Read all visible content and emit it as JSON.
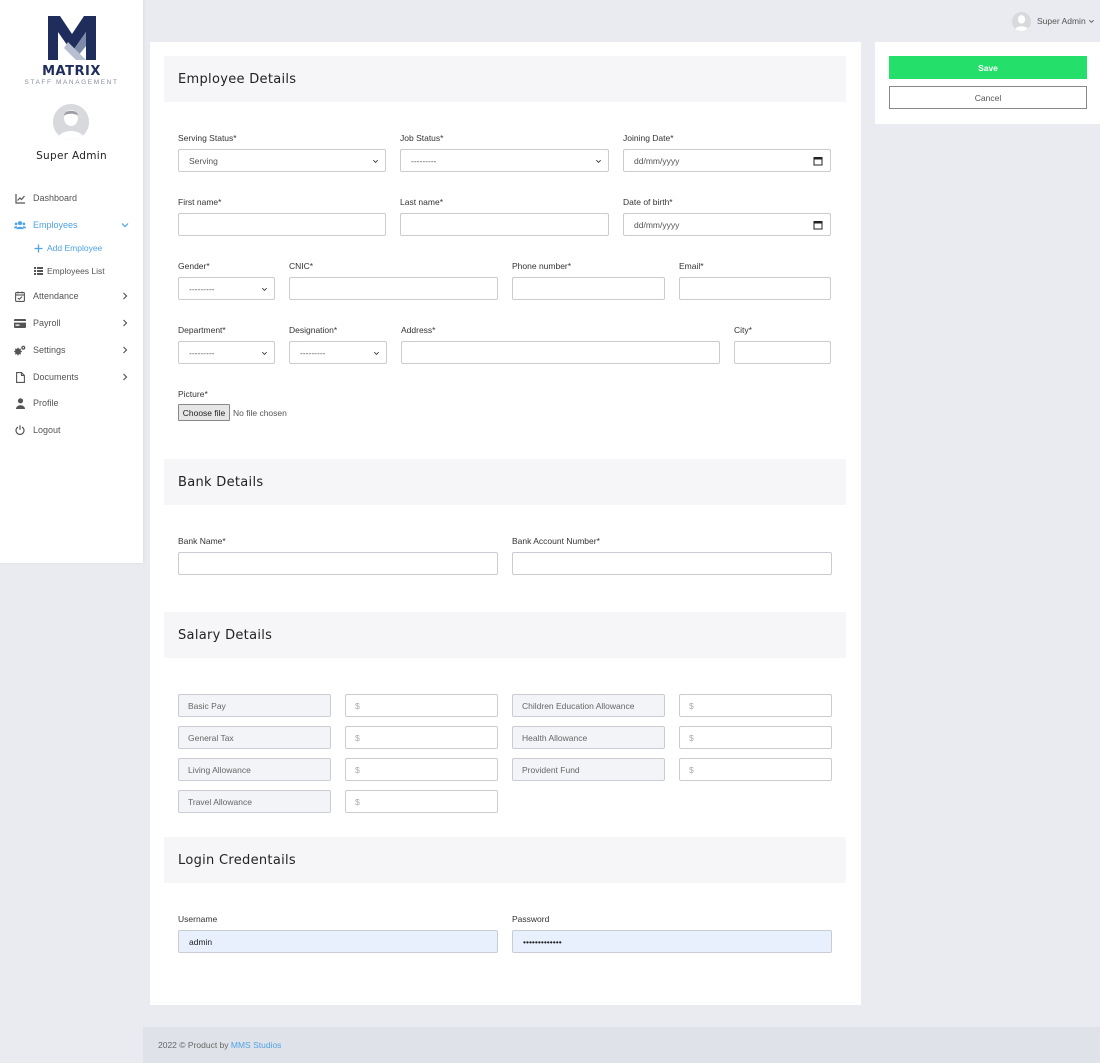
{
  "brand": {
    "name": "MATRIX",
    "subtitle": "STAFF MANAGEMENT",
    "accent": "#1f2d5c"
  },
  "sidebar": {
    "user_name": "Super Admin",
    "items": [
      {
        "label": "Dashboard",
        "icon": "chart-line-icon"
      },
      {
        "label": "Employees",
        "icon": "users-icon",
        "active": true,
        "expanded": true
      },
      {
        "label": "Attendance",
        "icon": "calendar-check-icon"
      },
      {
        "label": "Payroll",
        "icon": "credit-card-icon"
      },
      {
        "label": "Settings",
        "icon": "gears-icon"
      },
      {
        "label": "Documents",
        "icon": "file-icon"
      },
      {
        "label": "Profile",
        "icon": "user-icon"
      },
      {
        "label": "Logout",
        "icon": "power-icon"
      }
    ],
    "sub_items": [
      {
        "label": "Add Employee",
        "icon": "plus-icon",
        "active": true
      },
      {
        "label": "Employees List",
        "icon": "list-icon"
      }
    ]
  },
  "topbar": {
    "user_name": "Super Admin"
  },
  "employee": {
    "title": "Employee Details",
    "serving_status": {
      "label": "Serving Status*",
      "value": "Serving"
    },
    "job_status": {
      "label": "Job Status*",
      "value": "---------"
    },
    "joining_date": {
      "label": "Joining Date*",
      "value": "dd/mm/yyyy"
    },
    "first_name": {
      "label": "First name*",
      "value": ""
    },
    "last_name": {
      "label": "Last name*",
      "value": ""
    },
    "dob": {
      "label": "Date of birth*",
      "value": "dd/mm/yyyy"
    },
    "gender": {
      "label": "Gender*",
      "value": "---------"
    },
    "cnic": {
      "label": "CNIC*",
      "value": ""
    },
    "phone": {
      "label": "Phone number*",
      "value": ""
    },
    "email": {
      "label": "Email*",
      "value": ""
    },
    "department": {
      "label": "Department*",
      "value": "---------"
    },
    "designation": {
      "label": "Designation*",
      "value": "---------"
    },
    "address": {
      "label": "Address*",
      "value": ""
    },
    "city": {
      "label": "City*",
      "value": ""
    },
    "picture": {
      "label": "Picture*",
      "button": "Choose file",
      "status": "No file chosen"
    }
  },
  "bank": {
    "title": "Bank Details",
    "name_label": "Bank Name*",
    "account_label": "Bank Account Number*"
  },
  "salary": {
    "title": "Salary Details",
    "placeholder": "$",
    "basic_pay": "Basic Pay",
    "children_education": "Children Education Allowance",
    "general_tax": "General Tax",
    "health": "Health Allowance",
    "living": "Living Allowance",
    "provident": "Provident Fund",
    "travel": "Travel Allowance"
  },
  "login": {
    "title": "Login Credentails",
    "username_label": "Username",
    "username_value": "admin",
    "password_label": "Password",
    "password_value": "•••••••••••••"
  },
  "actions": {
    "save": "Save",
    "cancel": "Cancel",
    "save_color": "#24e06b"
  },
  "footer": {
    "text": "2022 © Product by ",
    "link": "MMS Studios"
  }
}
